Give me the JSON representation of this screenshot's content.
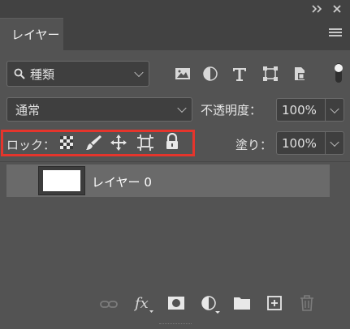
{
  "panel": {
    "tab_label": "レイヤー",
    "collapse_icon": "double-chevron-right-icon",
    "close_icon": "close-icon",
    "menu_icon": "panel-menu-icon"
  },
  "filter": {
    "label": "種類",
    "icons": [
      "image-filter-icon",
      "adjustment-filter-icon",
      "type-filter-icon",
      "shape-filter-icon",
      "smart-object-filter-icon"
    ]
  },
  "blend": {
    "mode": "通常",
    "opacity_label": "不透明度：",
    "opacity_value": "100%",
    "lock_label": "ロック：",
    "fill_label": "塗り：",
    "fill_value": "100%",
    "lock_icons": [
      "lock-transparent-pixels-icon",
      "lock-image-pixels-icon",
      "lock-position-icon",
      "lock-artboard-icon",
      "lock-all-icon"
    ],
    "highlight_color": "#e5352c"
  },
  "layers": [
    {
      "name": "レイヤー 0",
      "visible": true
    }
  ],
  "footer": {
    "icons": [
      "link-layers-icon",
      "fx-icon",
      "add-mask-icon",
      "adjustment-layer-icon",
      "new-group-icon",
      "new-layer-icon",
      "delete-layer-icon"
    ]
  }
}
